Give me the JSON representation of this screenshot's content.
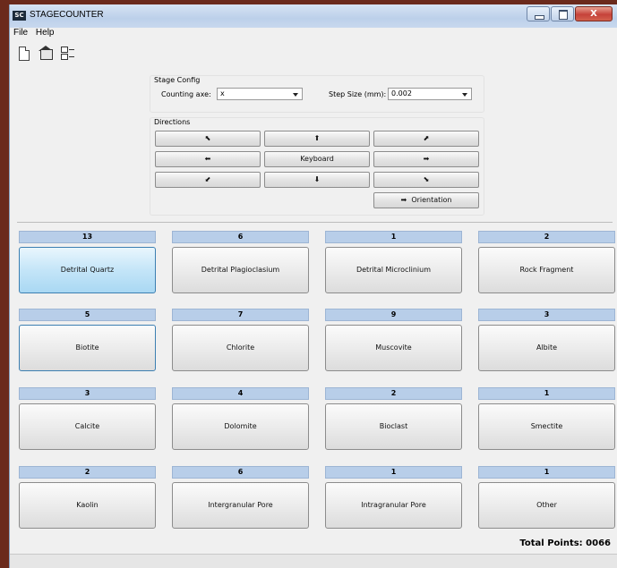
{
  "window": {
    "title": "STAGECOUNTER",
    "app_icon_text": "SC",
    "close_glyph": "X"
  },
  "menu": {
    "file": "File",
    "help": "Help"
  },
  "toolbar": {
    "icons": [
      "new-document-icon",
      "export-icon",
      "checklist-icon"
    ]
  },
  "stage_config": {
    "title": "Stage Config",
    "counting_axis_label": "Counting axe:",
    "counting_axis_value": "x",
    "step_size_label": "Step Size (mm):",
    "step_size_value": "0.002"
  },
  "directions": {
    "title": "Directions",
    "up_left": "⬉",
    "up": "⬆",
    "up_right": "⬈",
    "left": "⬅",
    "keyboard": "Keyboard",
    "right": "➡",
    "down_left": "⬋",
    "down": "⬇",
    "down_right": "⬊",
    "orientation": "Orientation",
    "orientation_icon": "➡"
  },
  "minerals": [
    {
      "count": "13",
      "label": "Detrital Quartz"
    },
    {
      "count": "6",
      "label": "Detrital Plagioclasium"
    },
    {
      "count": "1",
      "label": "Detrital Microclinium"
    },
    {
      "count": "2",
      "label": "Rock Fragment"
    },
    {
      "count": "5",
      "label": "Biotite"
    },
    {
      "count": "7",
      "label": "Chlorite"
    },
    {
      "count": "9",
      "label": "Muscovite"
    },
    {
      "count": "3",
      "label": "Albite"
    },
    {
      "count": "3",
      "label": "Calcite"
    },
    {
      "count": "4",
      "label": "Dolomite"
    },
    {
      "count": "2",
      "label": "Bioclast"
    },
    {
      "count": "1",
      "label": "Smectite"
    },
    {
      "count": "2",
      "label": "Kaolin"
    },
    {
      "count": "6",
      "label": "Intergranular Pore"
    },
    {
      "count": "1",
      "label": "Intragranular Pore"
    },
    {
      "count": "1",
      "label": "Other"
    }
  ],
  "total": {
    "text": "Total Points: 0066"
  },
  "colors": {
    "count_bar": "#b8cee9",
    "selected_button": "#c4e5f8",
    "desktop": "#6b2a1c"
  }
}
